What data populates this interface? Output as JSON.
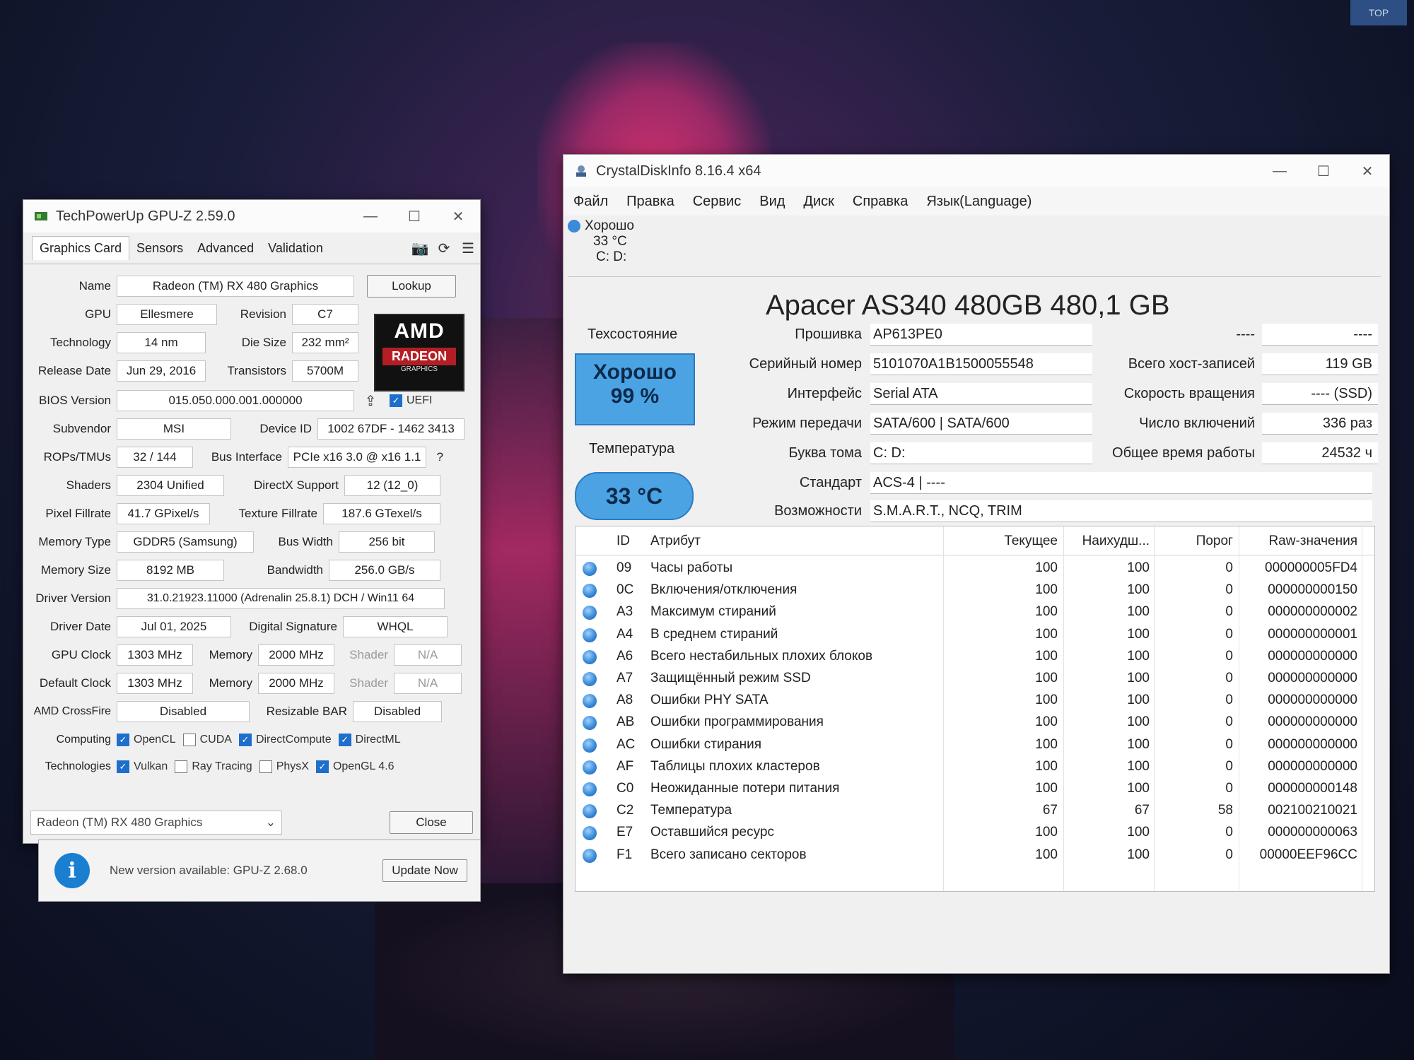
{
  "desktop": {
    "corner_badge": "TOP"
  },
  "gpuz": {
    "title": "TechPowerUp GPU-Z 2.59.0",
    "tabs": [
      "Graphics Card",
      "Sensors",
      "Advanced",
      "Validation"
    ],
    "fields": {
      "name_label": "Name",
      "name": "Radeon (TM) RX 480 Graphics",
      "lookup": "Lookup",
      "gpu_label": "GPU",
      "gpu": "Ellesmere",
      "revision_label": "Revision",
      "revision": "C7",
      "technology_label": "Technology",
      "technology": "14 nm",
      "die_size_label": "Die Size",
      "die_size": "232 mm²",
      "release_label": "Release Date",
      "release": "Jun 29, 2016",
      "transistors_label": "Transistors",
      "transistors": "5700M",
      "bios_label": "BIOS Version",
      "bios": "015.050.000.001.000000",
      "uefi": "UEFI",
      "subvendor_label": "Subvendor",
      "subvendor": "MSI",
      "device_id_label": "Device ID",
      "device_id": "1002 67DF - 1462 3413",
      "rops_label": "ROPs/TMUs",
      "rops": "32 / 144",
      "bus_label": "Bus Interface",
      "bus": "PCIe x16 3.0 @ x16 1.1",
      "bus_help": "?",
      "shaders_label": "Shaders",
      "shaders": "2304 Unified",
      "directx_label": "DirectX Support",
      "directx": "12 (12_0)",
      "pixel_label": "Pixel Fillrate",
      "pixel": "41.7 GPixel/s",
      "texture_label": "Texture Fillrate",
      "texture": "187.6 GTexel/s",
      "memtype_label": "Memory Type",
      "memtype": "GDDR5 (Samsung)",
      "buswidth_label": "Bus Width",
      "buswidth": "256 bit",
      "memsize_label": "Memory Size",
      "memsize": "8192 MB",
      "bandwidth_label": "Bandwidth",
      "bandwidth": "256.0 GB/s",
      "driver_label": "Driver Version",
      "driver": "31.0.21923.11000 (Adrenalin 25.8.1) DCH / Win11 64",
      "driverdate_label": "Driver Date",
      "driverdate": "Jul 01, 2025",
      "signature_label": "Digital Signature",
      "signature": "WHQL",
      "gpuclock_label": "GPU Clock",
      "gpuclock": "1303 MHz",
      "memory_label": "Memory",
      "memclock": "2000 MHz",
      "shader_label": "Shader",
      "shaderclock": "N/A",
      "defclock_label": "Default Clock",
      "defclock": "1303 MHz",
      "defmem": "2000 MHz",
      "defshader": "N/A",
      "crossfire_label": "AMD CrossFire",
      "crossfire": "Disabled",
      "rebar_label": "Resizable BAR",
      "rebar": "Disabled",
      "computing_label": "Computing",
      "technologies_label": "Technologies"
    },
    "computing": [
      {
        "label": "OpenCL",
        "checked": true
      },
      {
        "label": "CUDA",
        "checked": false
      },
      {
        "label": "DirectCompute",
        "checked": true
      },
      {
        "label": "DirectML",
        "checked": true
      }
    ],
    "technologies": [
      {
        "label": "Vulkan",
        "checked": true
      },
      {
        "label": "Ray Tracing",
        "checked": false
      },
      {
        "label": "PhysX",
        "checked": false
      },
      {
        "label": "OpenGL 4.6",
        "checked": true
      }
    ],
    "logo": {
      "brand": "AMD",
      "line1": "RADEON",
      "line2": "GRAPHICS"
    },
    "footer": {
      "selected_card": "Radeon (TM) RX 480 Graphics",
      "close": "Close"
    },
    "notice": {
      "text": "New version available: GPU-Z 2.68.0",
      "button": "Update Now"
    }
  },
  "cdi": {
    "title": "CrystalDiskInfo 8.16.4 x64",
    "menu": [
      "Файл",
      "Правка",
      "Сервис",
      "Вид",
      "Диск",
      "Справка",
      "Язык(Language)"
    ],
    "drive_tab": {
      "status": "Хорошо",
      "temp": "33 °C",
      "letters": "C: D:"
    },
    "model": "Apacer AS340 480GB 480,1 GB",
    "health": {
      "label": "Техсостояние",
      "status": "Хорошо",
      "percent": "99 %"
    },
    "temperature": {
      "label": "Температура",
      "value": "33 °C"
    },
    "info": {
      "firmware_label": "Прошивка",
      "firmware": "AP613PE0",
      "serial_label": "Серийный номер",
      "serial": "5101070A1B1500055548",
      "interface_label": "Интерфейс",
      "interface": "Serial ATA",
      "transfer_label": "Режим передачи",
      "transfer": "SATA/600 | SATA/600",
      "volume_label": "Буква тома",
      "volume": "C: D:",
      "standard_label": "Стандарт",
      "standard": "ACS-4 | ----",
      "features_label": "Возможности",
      "features": "S.M.A.R.T., NCQ, TRIM",
      "blank_label": "----",
      "blank_value": "----",
      "host_writes_label": "Всего хост-записей",
      "host_writes": "119 GB",
      "rotation_label": "Скорость вращения",
      "rotation": "---- (SSD)",
      "power_count_label": "Число включений",
      "power_count": "336 раз",
      "power_hours_label": "Общее время работы",
      "power_hours": "24532 ч"
    },
    "smart_headers": {
      "id": "ID",
      "attr": "Атрибут",
      "current": "Текущее",
      "worst": "Наихудш...",
      "threshold": "Порог",
      "raw": "Raw-значения"
    },
    "smart_rows": [
      {
        "id": "09",
        "name": "Часы работы",
        "current": "100",
        "worst": "100",
        "threshold": "0",
        "raw": "000000005FD4"
      },
      {
        "id": "0C",
        "name": "Включения/отключения",
        "current": "100",
        "worst": "100",
        "threshold": "0",
        "raw": "000000000150"
      },
      {
        "id": "A3",
        "name": "Максимум стираний",
        "current": "100",
        "worst": "100",
        "threshold": "0",
        "raw": "000000000002"
      },
      {
        "id": "A4",
        "name": "В среднем стираний",
        "current": "100",
        "worst": "100",
        "threshold": "0",
        "raw": "000000000001"
      },
      {
        "id": "A6",
        "name": "Всего нестабильных плохих блоков",
        "current": "100",
        "worst": "100",
        "threshold": "0",
        "raw": "000000000000"
      },
      {
        "id": "A7",
        "name": "Защищённый режим SSD",
        "current": "100",
        "worst": "100",
        "threshold": "0",
        "raw": "000000000000"
      },
      {
        "id": "A8",
        "name": "Ошибки PHY SATA",
        "current": "100",
        "worst": "100",
        "threshold": "0",
        "raw": "000000000000"
      },
      {
        "id": "AB",
        "name": "Ошибки программирования",
        "current": "100",
        "worst": "100",
        "threshold": "0",
        "raw": "000000000000"
      },
      {
        "id": "AC",
        "name": "Ошибки стирания",
        "current": "100",
        "worst": "100",
        "threshold": "0",
        "raw": "000000000000"
      },
      {
        "id": "AF",
        "name": "Таблицы плохих кластеров",
        "current": "100",
        "worst": "100",
        "threshold": "0",
        "raw": "000000000000"
      },
      {
        "id": "C0",
        "name": "Неожиданные потери питания",
        "current": "100",
        "worst": "100",
        "threshold": "0",
        "raw": "000000000148"
      },
      {
        "id": "C2",
        "name": "Температура",
        "current": "67",
        "worst": "67",
        "threshold": "58",
        "raw": "002100210021"
      },
      {
        "id": "E7",
        "name": "Оставшийся ресурс",
        "current": "100",
        "worst": "100",
        "threshold": "0",
        "raw": "000000000063"
      },
      {
        "id": "F1",
        "name": "Всего записано секторов",
        "current": "100",
        "worst": "100",
        "threshold": "0",
        "raw": "00000EEF96CC"
      }
    ]
  }
}
